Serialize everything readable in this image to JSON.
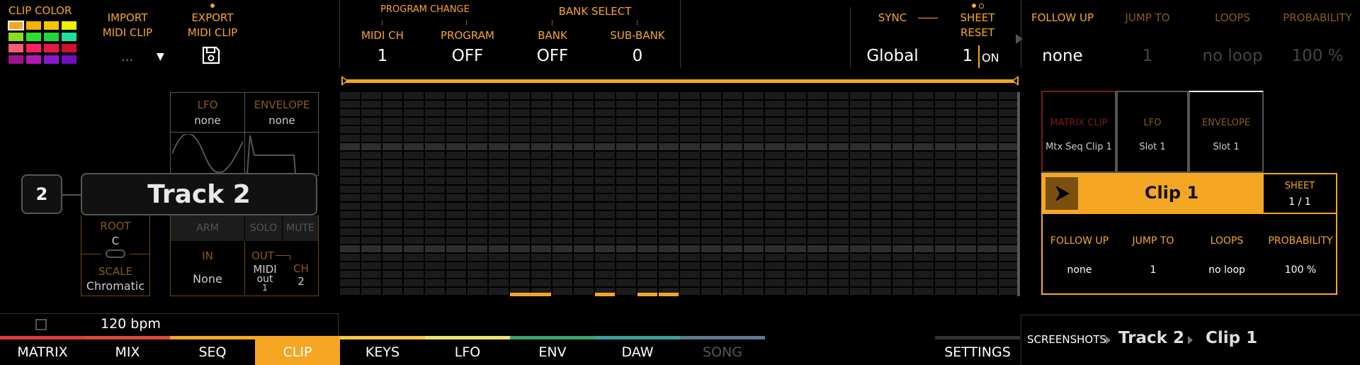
{
  "clip_color": {
    "label": "CLIP COLOR",
    "swatches": [
      "#f5a623",
      "#f5b000",
      "#f5c400",
      "#f0f000",
      "#8ddc20",
      "#2ee02e",
      "#20d840",
      "#20e0a0",
      "#ff5a7a",
      "#ff2060",
      "#e81848",
      "#d01030",
      "#a0108a",
      "#b418b4",
      "#8a18d0",
      "#7010c0"
    ]
  },
  "import": {
    "label_line1": "IMPORT",
    "label_line2": "MIDI CLIP",
    "value": "...",
    "dropdown": "▼"
  },
  "export": {
    "label_line1": "EXPORT",
    "label_line2": "MIDI CLIP"
  },
  "program_change": {
    "label": "PROGRAM CHANGE"
  },
  "bank_select": {
    "label": "BANK SELECT"
  },
  "midi_ch": {
    "label": "MIDI CH",
    "value": "1"
  },
  "program": {
    "label": "PROGRAM",
    "value": "OFF"
  },
  "bank": {
    "label": "BANK",
    "value": "OFF"
  },
  "sub_bank": {
    "label": "SUB-BANK",
    "value": "0"
  },
  "sync": {
    "label": "SYNC",
    "value": "Global"
  },
  "sheet_reset": {
    "label_line1": "SHEET",
    "label_line2": "RESET",
    "value": "1",
    "toggle": "ON"
  },
  "header_right": {
    "follow_up": {
      "label": "FOLLOW UP",
      "value": "none"
    },
    "jump_to": {
      "label": "JUMP TO",
      "value": "1"
    },
    "loops": {
      "label": "LOOPS",
      "value": "no loop"
    },
    "probability": {
      "label": "PROBABILITY",
      "value": "100 %"
    }
  },
  "mod": {
    "lfo": {
      "label": "LFO",
      "value": "none"
    },
    "envelope": {
      "label": "ENVELOPE",
      "value": "none"
    }
  },
  "track": {
    "number": "2",
    "name": "Track 2"
  },
  "root": {
    "label": "ROOT",
    "value": "C"
  },
  "scale": {
    "label": "SCALE",
    "value": "Chromatic"
  },
  "arm": {
    "label": "ARM"
  },
  "solo": {
    "label": "SOLO"
  },
  "mute": {
    "label": "MUTE"
  },
  "in": {
    "label": "IN",
    "value": "None"
  },
  "out": {
    "label": "OUT",
    "value_line1": "MIDI",
    "value_line2": "out",
    "value_line3": "1"
  },
  "ch": {
    "label": "CH",
    "value": "2"
  },
  "tempo": {
    "bpm": "120 bpm"
  },
  "right_panel": {
    "matrix_clip": {
      "label": "MATRIX CLIP",
      "value": "Mtx Seq Clip 1"
    },
    "lfo": {
      "label": "LFO",
      "value": "Slot 1"
    },
    "envelope": {
      "label": "ENVELOPE",
      "value": "Slot 1"
    },
    "clip_name": "Clip 1",
    "sheet": {
      "label": "SHEET",
      "value": "1 / 1"
    },
    "follow_up": {
      "label": "FOLLOW UP",
      "value": "none"
    },
    "jump_to": {
      "label": "JUMP TO",
      "value": "1"
    },
    "loops": {
      "label": "LOOPS",
      "value": "no loop"
    },
    "probability": {
      "label": "PROBABILITY",
      "value": "100 %"
    }
  },
  "tabs": [
    {
      "label": "MATRIX",
      "color": "#e03a3a"
    },
    {
      "label": "MIX",
      "color": "#e04a3a"
    },
    {
      "label": "SEQ",
      "color": "#f5a623"
    },
    {
      "label": "CLIP",
      "color": "#f5a623",
      "active": true
    },
    {
      "label": "KEYS",
      "color": "#f5c84a"
    },
    {
      "label": "LFO",
      "color": "#f0e070"
    },
    {
      "label": "ENV",
      "color": "#3aa070"
    },
    {
      "label": "DAW",
      "color": "#3aa0a0"
    },
    {
      "label": "SONG",
      "color": "#607890"
    }
  ],
  "settings": {
    "label": "SETTINGS"
  },
  "breadcrumb": {
    "root": "SCREENSHOTS",
    "track": "Track 2",
    "clip": "Clip 1"
  },
  "colors": {
    "accent": "#f5a623",
    "background": "#000000"
  }
}
